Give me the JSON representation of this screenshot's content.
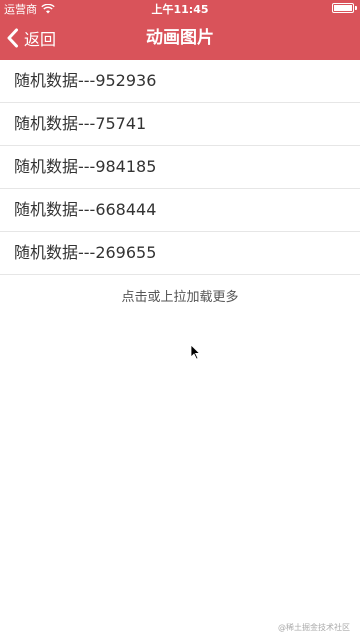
{
  "status_bar": {
    "carrier": "运营商",
    "time": "上午11:45",
    "battery_level": 1.0
  },
  "nav": {
    "back_label": "返回",
    "title": "动画图片"
  },
  "list": {
    "items": [
      "随机数据---952936",
      "随机数据---75741",
      "随机数据---984185",
      "随机数据---668444",
      "随机数据---269655"
    ]
  },
  "load_more": "点击或上拉加载更多",
  "watermark": "@稀土掘金技术社区",
  "colors": {
    "accent": "#d9535a",
    "divider": "#e6e6e6"
  },
  "icons": {
    "back": "chevron-left-icon",
    "wifi": "wifi-icon",
    "battery": "battery-icon",
    "cursor": "mouse-pointer-icon"
  }
}
